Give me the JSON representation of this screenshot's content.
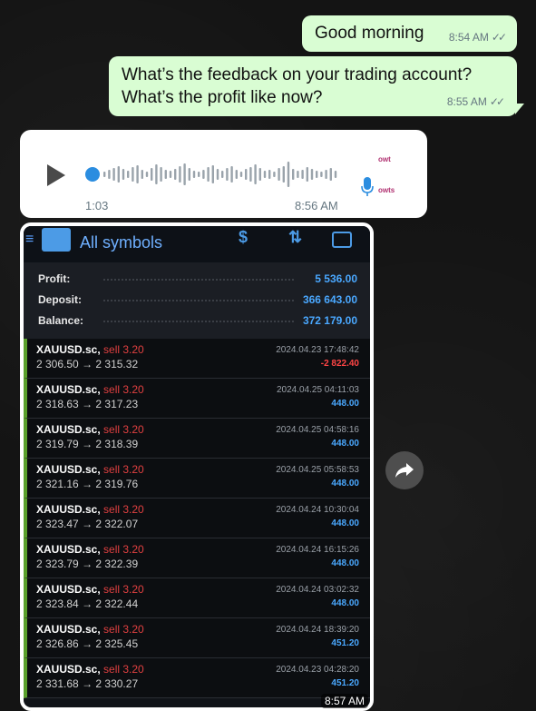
{
  "messages": {
    "msg1": {
      "text": "Good morning",
      "time": "8:54 AM"
    },
    "msg2": {
      "line1": "What’s the feedback on your trading account?",
      "line2": "What’s the profit like now?",
      "time": "8:55 AM"
    },
    "read_ticks": "✓✓"
  },
  "voice": {
    "duration": "1:03",
    "time": "8:56 AM",
    "brand_top": "owt",
    "brand_mid": "",
    "brand_bottom": "owts"
  },
  "screenshot": {
    "title": "All symbols",
    "summary": [
      {
        "label": "Profit:",
        "value": "5 536.00"
      },
      {
        "label": "Deposit:",
        "value": "366 643.00"
      },
      {
        "label": "Balance:",
        "value": "372 179.00"
      }
    ],
    "trades": [
      {
        "symbol": "XAUUSD.sc,",
        "side": "sell 3.20",
        "open": "2 306.50",
        "close": "2 315.32",
        "date": "2024.04.23 17:48:42",
        "pnl": "-2 822.40",
        "sign": "neg"
      },
      {
        "symbol": "XAUUSD.sc,",
        "side": "sell 3.20",
        "open": "2 318.63",
        "close": "2 317.23",
        "date": "2024.04.25 04:11:03",
        "pnl": "448.00",
        "sign": "pos"
      },
      {
        "symbol": "XAUUSD.sc,",
        "side": "sell 3.20",
        "open": "2 319.79",
        "close": "2 318.39",
        "date": "2024.04.25 04:58:16",
        "pnl": "448.00",
        "sign": "pos"
      },
      {
        "symbol": "XAUUSD.sc,",
        "side": "sell 3.20",
        "open": "2 321.16",
        "close": "2 319.76",
        "date": "2024.04.25 05:58:53",
        "pnl": "448.00",
        "sign": "pos"
      },
      {
        "symbol": "XAUUSD.sc,",
        "side": "sell 3.20",
        "open": "2 323.47",
        "close": "2 322.07",
        "date": "2024.04.24 10:30:04",
        "pnl": "448.00",
        "sign": "pos"
      },
      {
        "symbol": "XAUUSD.sc,",
        "side": "sell 3.20",
        "open": "2 323.79",
        "close": "2 322.39",
        "date": "2024.04.24 16:15:26",
        "pnl": "448.00",
        "sign": "pos"
      },
      {
        "symbol": "XAUUSD.sc,",
        "side": "sell 3.20",
        "open": "2 323.84",
        "close": "2 322.44",
        "date": "2024.04.24 03:02:32",
        "pnl": "448.00",
        "sign": "pos"
      },
      {
        "symbol": "XAUUSD.sc,",
        "side": "sell 3.20",
        "open": "2 326.86",
        "close": "2 325.45",
        "date": "2024.04.24 18:39:20",
        "pnl": "451.20",
        "sign": "pos"
      },
      {
        "symbol": "XAUUSD.sc,",
        "side": "sell 3.20",
        "open": "2 331.68",
        "close": "2 330.27",
        "date": "2024.04.23 04:28:20",
        "pnl": "451.20",
        "sign": "pos"
      }
    ],
    "arrow": "→",
    "time": "8:57 AM"
  },
  "colors": {
    "outgoing_bubble": "#d9fdd3",
    "accent_blue": "#4aa8ff",
    "loss_red": "#ff4545",
    "sell_red": "#e04040"
  },
  "icons": {
    "play": "play-icon",
    "mic": "mic-icon",
    "forward": "forward-icon"
  }
}
